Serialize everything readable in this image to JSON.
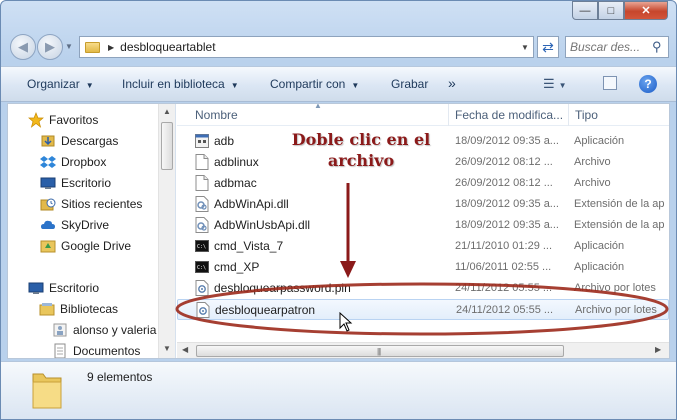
{
  "window": {
    "caption_buttons": {
      "minimize": "—",
      "maximize": "□",
      "close": "✕"
    }
  },
  "address_bar": {
    "back_icon": "arrow-left-icon",
    "forward_icon": "arrow-right-icon",
    "breadcrumb": "desbloqueartablet",
    "refresh_icon": "refresh-icon"
  },
  "search": {
    "placeholder": "Buscar des..."
  },
  "toolbar": {
    "organize_label": "Organizar",
    "include_label": "Incluir en biblioteca",
    "share_label": "Compartir con",
    "burn_label": "Grabar",
    "more_label": "»",
    "help_label": "?"
  },
  "nav_pane": {
    "favorites_label": "Favoritos",
    "favorites": [
      "Descargas",
      "Dropbox",
      "Escritorio",
      "Sitios recientes",
      "SkyDrive",
      "Google Drive"
    ],
    "desktop_label": "Escritorio",
    "libraries_label": "Bibliotecas",
    "libraries": [
      "alonso y valeria",
      "Documentos"
    ]
  },
  "columns": {
    "name": "Nombre",
    "date": "Fecha de modifica...",
    "type": "Tipo"
  },
  "files": [
    {
      "name": "adb",
      "date": "18/09/2012 09:35 a...",
      "type": "Aplicación",
      "icon": "exe-icon"
    },
    {
      "name": "adblinux",
      "date": "26/09/2012 08:12 ...",
      "type": "Archivo",
      "icon": "file-icon"
    },
    {
      "name": "adbmac",
      "date": "26/09/2012 08:12 ...",
      "type": "Archivo",
      "icon": "file-icon"
    },
    {
      "name": "AdbWinApi.dll",
      "date": "18/09/2012 09:35 a...",
      "type": "Extensión de la ap",
      "icon": "dll-icon"
    },
    {
      "name": "AdbWinUsbApi.dll",
      "date": "18/09/2012 09:35 a...",
      "type": "Extensión de la ap",
      "icon": "dll-icon"
    },
    {
      "name": "cmd_Vista_7",
      "date": "21/11/2010 01:29 ...",
      "type": "Aplicación",
      "icon": "cmd-icon"
    },
    {
      "name": "cmd_XP",
      "date": "11/06/2011 02:55 ...",
      "type": "Aplicación",
      "icon": "cmd-icon"
    },
    {
      "name": "desbloquearpassword.pin",
      "date": "24/11/2012 05:55 ...",
      "type": "Archivo por lotes",
      "icon": "batch-icon"
    },
    {
      "name": "desbloquearpatron",
      "date": "24/11/2012 05:55 ...",
      "type": "Archivo por lotes",
      "icon": "batch-icon"
    }
  ],
  "details": {
    "count": "9 elementos"
  },
  "annotation": {
    "line1": "Doble clic en el",
    "line2": "archivo"
  },
  "colors": {
    "annotation": "#8b1a1a",
    "selection": "#e3eefb",
    "toolbar_text": "#1e395b"
  }
}
